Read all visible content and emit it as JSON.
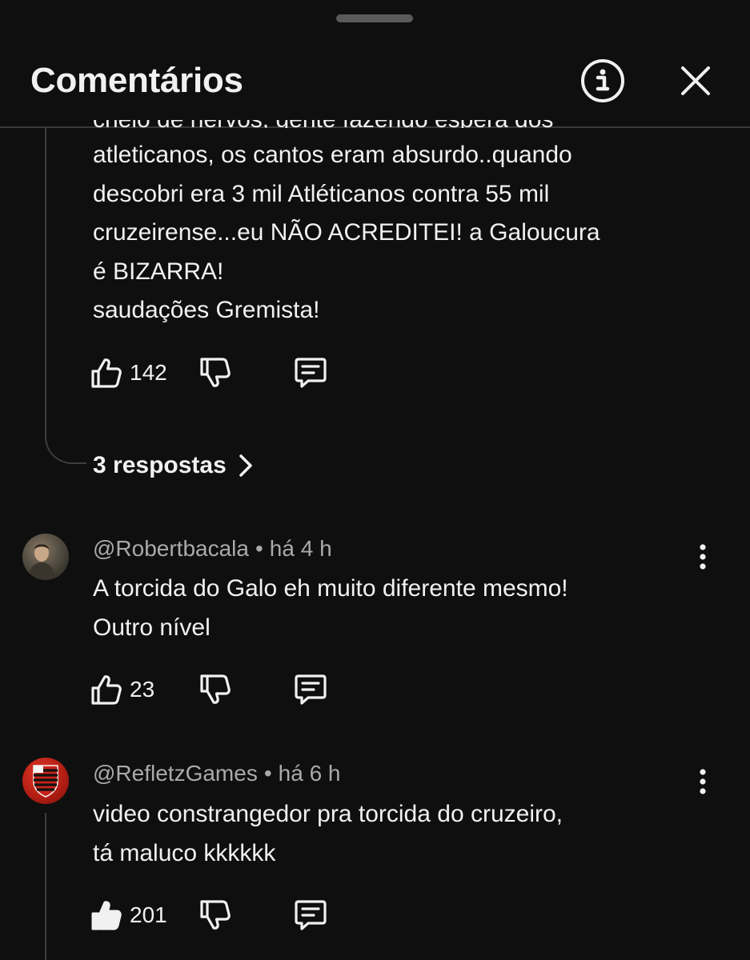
{
  "header": {
    "title": "Comentários",
    "info_icon": "info-icon",
    "close_icon": "close-icon"
  },
  "thread": {
    "partial_line": "cheio de nervos, gente fazendo espera dos",
    "comment_lines": [
      "atleticanos, os cantos eram absurdo..quando",
      "descobri era 3 mil Atléticanos contra 55 mil",
      "cruzeirense...eu NÃO ACREDITEI! a Galoucura",
      "é BIZARRA!",
      "saudações Gremista!"
    ],
    "likes": "142",
    "replies_label": "3 respostas",
    "replies_icon": "chevron-right-icon"
  },
  "comments": [
    {
      "author": "@Robertbacala",
      "separator": "•",
      "time": "há 4 h",
      "lines": [
        "A torcida do Galo eh muito diferente mesmo!",
        "Outro nível"
      ],
      "likes": "23",
      "liked": false
    },
    {
      "author": "@RefletzGames",
      "separator": "•",
      "time": "há 6 h",
      "lines": [
        "video constrangedor pra torcida do cruzeiro,",
        "tá maluco kkkkkk"
      ],
      "likes": "201",
      "liked": true
    }
  ],
  "icons": {
    "like": "thumbs-up-icon",
    "dislike": "thumbs-down-icon",
    "reply": "comment-reply-icon",
    "more": "more-vertical-icon"
  },
  "colors": {
    "background": "#0f0f0f",
    "text": "#f1f1f1",
    "secondary_text": "#aaaaaa",
    "avatar_flamengo_red": "#c0241a"
  }
}
